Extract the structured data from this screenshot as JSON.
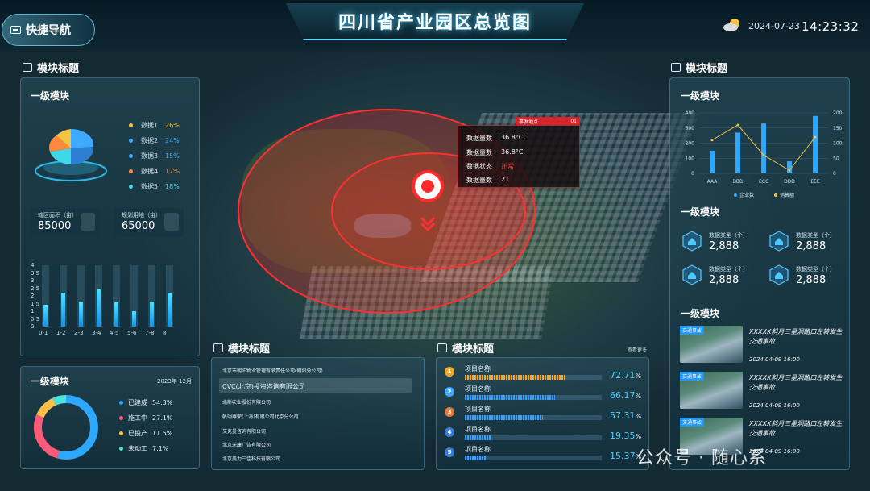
{
  "header": {
    "title": "四川省产业园区总览图",
    "nav_label": "快捷导航",
    "date": "2024-07-23",
    "time": "14:23:32"
  },
  "left": {
    "section_title": "模块标题",
    "panel1_title": "一级模块",
    "legend": [
      {
        "label": "数据1",
        "pct": "26%",
        "color": "#f5c542"
      },
      {
        "label": "数据2",
        "pct": "24%",
        "color": "#3fa9ff"
      },
      {
        "label": "数据3",
        "pct": "15%",
        "color": "#3fa9ff"
      },
      {
        "label": "数据4",
        "pct": "17%",
        "color": "#ff8a3d"
      },
      {
        "label": "数据5",
        "pct": "18%",
        "color": "#3fd8e8"
      }
    ],
    "stat1_label": "辖区面积（亩）",
    "stat1_value": "85000",
    "stat2_label": "规划用地（亩）",
    "stat2_value": "65000",
    "bars": {
      "categories": [
        "0-1",
        "1-2",
        "2-3",
        "3-4",
        "4-5",
        "5-6",
        "7-8",
        "8"
      ],
      "values": [
        1.4,
        2.2,
        1.6,
        2.4,
        1.6,
        1.0,
        1.6,
        2.2
      ],
      "yticks": [
        "0",
        "0.5",
        "1",
        "1.5",
        "2",
        "2.5",
        "3",
        "3.5",
        "4"
      ]
    },
    "panel2_title": "一级模块",
    "panel2_date": "2023年 12月",
    "donut": [
      {
        "label": "已建成",
        "pct": "54.3%",
        "value": 54.3,
        "color": "#2ea8ff"
      },
      {
        "label": "施工中",
        "pct": "27.1%",
        "value": 27.1,
        "color": "#ff5a7a"
      },
      {
        "label": "已投产",
        "pct": "11.5%",
        "value": 11.5,
        "color": "#ffc04a"
      },
      {
        "label": "未动工",
        "pct": "7.1%",
        "value": 7.1,
        "color": "#4fe0d8"
      }
    ]
  },
  "center": {
    "popup": {
      "head": "事发地点",
      "head_right": "01",
      "rows": [
        {
          "k": "数据量数",
          "v": "36.8°C"
        },
        {
          "k": "数据量数",
          "v": "36.8°C"
        },
        {
          "k": "数据状态",
          "v": "正常"
        },
        {
          "k": "数据量数",
          "v": "21"
        }
      ]
    },
    "companies_title": "模块标题",
    "companies": [
      "北京市朝阳物业管理有限责任公司(朝阳分公司)",
      "CVC(北京)投资咨询有限公司",
      "北斯农业股份有限公司",
      "帆翊尊荣(上海)有限公司北京分公司",
      "艾克曼咨询有限公司",
      "北京禾康广告有限公司",
      "北京美力三佳科技有限公司"
    ],
    "projects_title": "模块标题",
    "projects_more": "查看更多",
    "projects": [
      {
        "rank": "1",
        "name": "项目名称",
        "pct": "72.71",
        "value": 72.71,
        "color": "#f5a623"
      },
      {
        "rank": "2",
        "name": "项目名称",
        "pct": "66.17",
        "value": 66.17,
        "color": "#3fa9ff"
      },
      {
        "rank": "3",
        "name": "项目名称",
        "pct": "57.31",
        "value": 57.31,
        "color": "#e07a3a"
      },
      {
        "rank": "4",
        "name": "项目名称",
        "pct": "19.35",
        "value": 19.35,
        "color": "#3a7bd5"
      },
      {
        "rank": "5",
        "name": "项目名称",
        "pct": "15.37",
        "value": 15.37,
        "color": "#3a7bd5"
      }
    ],
    "pct_unit": "%"
  },
  "right": {
    "section_title": "模块标题",
    "panel1_title": "一级模块",
    "chart_data": {
      "type": "bar",
      "categories": [
        "AAA",
        "BBB",
        "CCC",
        "DDD",
        "EEE"
      ],
      "series": [
        {
          "name": "企业数",
          "values": [
            150,
            270,
            330,
            80,
            380
          ],
          "color": "#2ea8ff"
        },
        {
          "name": "销售额",
          "values": [
            110,
            160,
            60,
            10,
            120
          ],
          "color": "#f5c542"
        }
      ],
      "yleft": [
        "0",
        "100",
        "200",
        "300",
        "400"
      ],
      "yright": [
        "0",
        "50",
        "100",
        "150",
        "200"
      ],
      "ylim_left": [
        0,
        400
      ],
      "ylim_right": [
        0,
        200
      ]
    },
    "panel2_title": "一级模块",
    "kpis": [
      {
        "label": "数据类型（个）",
        "value": "2,888"
      },
      {
        "label": "数据类型（个）",
        "value": "2,888"
      },
      {
        "label": "数据类型（个）",
        "value": "2,888"
      },
      {
        "label": "数据类型（个）",
        "value": "2,888"
      }
    ],
    "panel3_title": "一级模块",
    "news": [
      {
        "tag": "交通事故",
        "title": "XXXXX斜月三星洞路口左转发生交通事故",
        "date": "2024  04-09  16:00"
      },
      {
        "tag": "交通事故",
        "title": "XXXXX斜月三星洞路口左转发生交通事故",
        "date": "2024  04-09  16:00"
      },
      {
        "tag": "交通事故",
        "title": "XXXXX斜月三星洞路口左转发生交通事故",
        "date": "2024  04-09  16:00"
      }
    ]
  },
  "watermark": "公众号 · 随心系"
}
